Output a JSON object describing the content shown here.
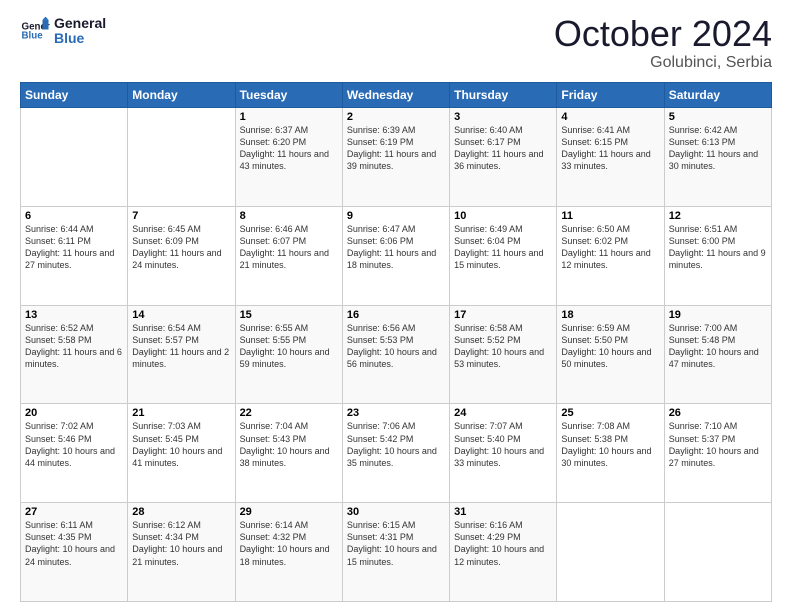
{
  "logo": {
    "line1": "General",
    "line2": "Blue"
  },
  "title": "October 2024",
  "subtitle": "Golubinci, Serbia",
  "days_header": [
    "Sunday",
    "Monday",
    "Tuesday",
    "Wednesday",
    "Thursday",
    "Friday",
    "Saturday"
  ],
  "weeks": [
    [
      {
        "day": "",
        "info": ""
      },
      {
        "day": "",
        "info": ""
      },
      {
        "day": "1",
        "info": "Sunrise: 6:37 AM\nSunset: 6:20 PM\nDaylight: 11 hours and 43 minutes."
      },
      {
        "day": "2",
        "info": "Sunrise: 6:39 AM\nSunset: 6:19 PM\nDaylight: 11 hours and 39 minutes."
      },
      {
        "day": "3",
        "info": "Sunrise: 6:40 AM\nSunset: 6:17 PM\nDaylight: 11 hours and 36 minutes."
      },
      {
        "day": "4",
        "info": "Sunrise: 6:41 AM\nSunset: 6:15 PM\nDaylight: 11 hours and 33 minutes."
      },
      {
        "day": "5",
        "info": "Sunrise: 6:42 AM\nSunset: 6:13 PM\nDaylight: 11 hours and 30 minutes."
      }
    ],
    [
      {
        "day": "6",
        "info": "Sunrise: 6:44 AM\nSunset: 6:11 PM\nDaylight: 11 hours and 27 minutes."
      },
      {
        "day": "7",
        "info": "Sunrise: 6:45 AM\nSunset: 6:09 PM\nDaylight: 11 hours and 24 minutes."
      },
      {
        "day": "8",
        "info": "Sunrise: 6:46 AM\nSunset: 6:07 PM\nDaylight: 11 hours and 21 minutes."
      },
      {
        "day": "9",
        "info": "Sunrise: 6:47 AM\nSunset: 6:06 PM\nDaylight: 11 hours and 18 minutes."
      },
      {
        "day": "10",
        "info": "Sunrise: 6:49 AM\nSunset: 6:04 PM\nDaylight: 11 hours and 15 minutes."
      },
      {
        "day": "11",
        "info": "Sunrise: 6:50 AM\nSunset: 6:02 PM\nDaylight: 11 hours and 12 minutes."
      },
      {
        "day": "12",
        "info": "Sunrise: 6:51 AM\nSunset: 6:00 PM\nDaylight: 11 hours and 9 minutes."
      }
    ],
    [
      {
        "day": "13",
        "info": "Sunrise: 6:52 AM\nSunset: 5:58 PM\nDaylight: 11 hours and 6 minutes."
      },
      {
        "day": "14",
        "info": "Sunrise: 6:54 AM\nSunset: 5:57 PM\nDaylight: 11 hours and 2 minutes."
      },
      {
        "day": "15",
        "info": "Sunrise: 6:55 AM\nSunset: 5:55 PM\nDaylight: 10 hours and 59 minutes."
      },
      {
        "day": "16",
        "info": "Sunrise: 6:56 AM\nSunset: 5:53 PM\nDaylight: 10 hours and 56 minutes."
      },
      {
        "day": "17",
        "info": "Sunrise: 6:58 AM\nSunset: 5:52 PM\nDaylight: 10 hours and 53 minutes."
      },
      {
        "day": "18",
        "info": "Sunrise: 6:59 AM\nSunset: 5:50 PM\nDaylight: 10 hours and 50 minutes."
      },
      {
        "day": "19",
        "info": "Sunrise: 7:00 AM\nSunset: 5:48 PM\nDaylight: 10 hours and 47 minutes."
      }
    ],
    [
      {
        "day": "20",
        "info": "Sunrise: 7:02 AM\nSunset: 5:46 PM\nDaylight: 10 hours and 44 minutes."
      },
      {
        "day": "21",
        "info": "Sunrise: 7:03 AM\nSunset: 5:45 PM\nDaylight: 10 hours and 41 minutes."
      },
      {
        "day": "22",
        "info": "Sunrise: 7:04 AM\nSunset: 5:43 PM\nDaylight: 10 hours and 38 minutes."
      },
      {
        "day": "23",
        "info": "Sunrise: 7:06 AM\nSunset: 5:42 PM\nDaylight: 10 hours and 35 minutes."
      },
      {
        "day": "24",
        "info": "Sunrise: 7:07 AM\nSunset: 5:40 PM\nDaylight: 10 hours and 33 minutes."
      },
      {
        "day": "25",
        "info": "Sunrise: 7:08 AM\nSunset: 5:38 PM\nDaylight: 10 hours and 30 minutes."
      },
      {
        "day": "26",
        "info": "Sunrise: 7:10 AM\nSunset: 5:37 PM\nDaylight: 10 hours and 27 minutes."
      }
    ],
    [
      {
        "day": "27",
        "info": "Sunrise: 6:11 AM\nSunset: 4:35 PM\nDaylight: 10 hours and 24 minutes."
      },
      {
        "day": "28",
        "info": "Sunrise: 6:12 AM\nSunset: 4:34 PM\nDaylight: 10 hours and 21 minutes."
      },
      {
        "day": "29",
        "info": "Sunrise: 6:14 AM\nSunset: 4:32 PM\nDaylight: 10 hours and 18 minutes."
      },
      {
        "day": "30",
        "info": "Sunrise: 6:15 AM\nSunset: 4:31 PM\nDaylight: 10 hours and 15 minutes."
      },
      {
        "day": "31",
        "info": "Sunrise: 6:16 AM\nSunset: 4:29 PM\nDaylight: 10 hours and 12 minutes."
      },
      {
        "day": "",
        "info": ""
      },
      {
        "day": "",
        "info": ""
      }
    ]
  ]
}
